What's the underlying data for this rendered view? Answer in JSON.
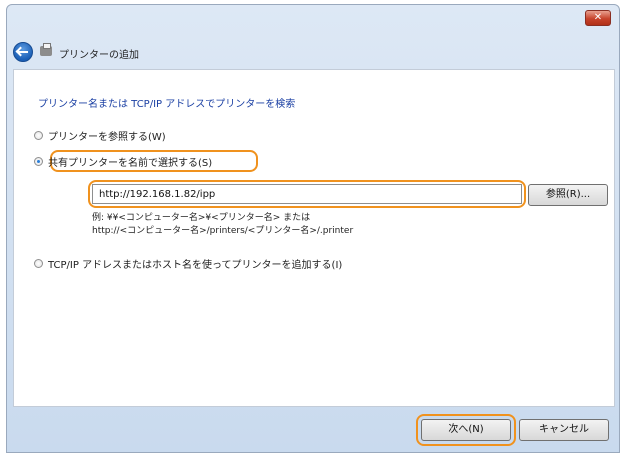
{
  "window": {
    "close_label": "✕"
  },
  "header": {
    "title": "プリンターの追加"
  },
  "main": {
    "instruction": "プリンター名または TCP/IP アドレスでプリンターを検索",
    "options": [
      {
        "label": "プリンターを参照する(W)",
        "checked": false
      },
      {
        "label": "共有プリンターを名前で選択する(S)",
        "checked": true
      },
      {
        "label": "TCP/IP アドレスまたはホスト名を使ってプリンターを追加する(I)",
        "checked": false
      }
    ],
    "url_input": {
      "value": "http://192.168.1.82/ipp"
    },
    "browse_label": "参照(R)...",
    "example_line1": "例: ¥¥<コンピューター名>¥<プリンター名> または",
    "example_line2": "http://<コンピューター名>/printers/<プリンター名>/.printer"
  },
  "footer": {
    "next_label": "次へ(N)",
    "cancel_label": "キャンセル"
  },
  "colors": {
    "highlight": "#f0921e",
    "instruction": "#1a3fa3"
  }
}
